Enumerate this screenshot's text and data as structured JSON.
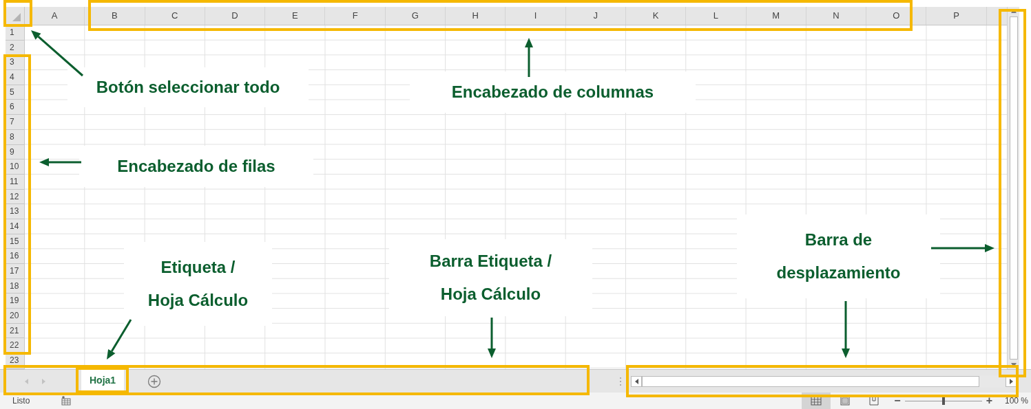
{
  "column_headers": [
    "A",
    "B",
    "C",
    "D",
    "E",
    "F",
    "G",
    "H",
    "I",
    "J",
    "K",
    "L",
    "M",
    "N",
    "O",
    "P"
  ],
  "row_headers": [
    "1",
    "2",
    "3",
    "4",
    "5",
    "6",
    "7",
    "8",
    "9",
    "10",
    "11",
    "12",
    "13",
    "14",
    "15",
    "16",
    "17",
    "18",
    "19",
    "20",
    "21",
    "22",
    "23"
  ],
  "sheet_tabs": [
    {
      "label": "Hoja1",
      "selected": true
    }
  ],
  "status_bar": {
    "status": "Listo",
    "view_buttons": [
      {
        "kind": "normal",
        "selected": true
      },
      {
        "kind": "page_layout",
        "selected": false
      },
      {
        "kind": "page_break",
        "selected": false
      }
    ],
    "zoom": {
      "minus": "−",
      "level": 0.5,
      "plus": "+",
      "reading": "100 %"
    }
  },
  "annotations": [
    {
      "lines": [
        "Botón seleccionar todo"
      ]
    },
    {
      "lines": [
        "Encabezado de columnas"
      ]
    },
    {
      "lines": [
        "Encabezado de filas"
      ]
    },
    {
      "lines": [
        "Etiqueta /",
        "Hoja Cálculo"
      ]
    },
    {
      "lines": [
        "Barra Etiqueta /",
        "Hoja Cálculo"
      ]
    },
    {
      "lines": [
        "Barra de",
        "desplazamiento"
      ]
    }
  ]
}
